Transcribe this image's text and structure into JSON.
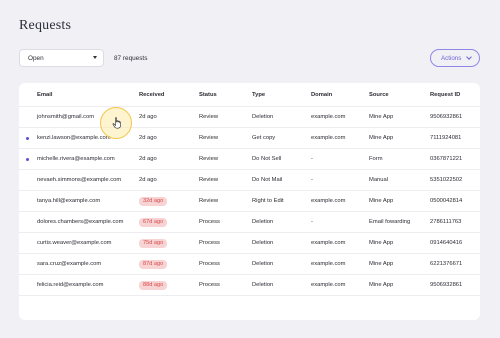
{
  "page": {
    "title": "Requests"
  },
  "filter": {
    "selected": "Open",
    "count_text": "87 requests"
  },
  "actions": {
    "label": "Actions"
  },
  "table": {
    "columns": [
      "Email",
      "Received",
      "Status",
      "Type",
      "Domain",
      "Source",
      "Request ID"
    ],
    "rows": [
      {
        "email": "johnsmith@gmail.com",
        "received": "2d ago",
        "overdue": false,
        "status": "Review",
        "type": "Deletion",
        "domain": "example.com",
        "source": "Mine App",
        "request_id": "9506932861",
        "unread": false
      },
      {
        "email": "kenzi.lawson@example.com",
        "received": "2d ago",
        "overdue": false,
        "status": "Review",
        "type": "Get copy",
        "domain": "example.com",
        "source": "Mine App",
        "request_id": "7111924081",
        "unread": true
      },
      {
        "email": "michelle.rivera@example.com",
        "received": "2d ago",
        "overdue": false,
        "status": "Review",
        "type": "Do Not Sell",
        "domain": "-",
        "source": "Form",
        "request_id": "0367871221",
        "unread": true
      },
      {
        "email": "nevaeh.simmons@example.com",
        "received": "2d ago",
        "overdue": false,
        "status": "Review",
        "type": "Do Not Mail",
        "domain": "-",
        "source": "Manual",
        "request_id": "5351022502",
        "unread": false
      },
      {
        "email": "tanya.hill@example.com",
        "received": "32d ago",
        "overdue": true,
        "status": "Review",
        "type": "Right to Edit",
        "domain": "example.com",
        "source": "Mine App",
        "request_id": "0500042814",
        "unread": false
      },
      {
        "email": "dolores.chambers@example.com",
        "received": "67d ago",
        "overdue": true,
        "status": "Process",
        "type": "Deletion",
        "domain": "-",
        "source": "Email fowarding",
        "request_id": "2786111763",
        "unread": false
      },
      {
        "email": "curtis.weaver@example.com",
        "received": "75d ago",
        "overdue": true,
        "status": "Process",
        "type": "Deletion",
        "domain": "example.com",
        "source": "Mine App",
        "request_id": "0914640416",
        "unread": false
      },
      {
        "email": "sara.cruz@example.com",
        "received": "87d ago",
        "overdue": true,
        "status": "Process",
        "type": "Deletion",
        "domain": "example.com",
        "source": "Mine App",
        "request_id": "6221376671",
        "unread": false
      },
      {
        "email": "felicia.reid@example.com",
        "received": "88d ago",
        "overdue": true,
        "status": "Process",
        "type": "Deletion",
        "domain": "example.com",
        "source": "Mine App",
        "request_id": "9506932861",
        "unread": false
      }
    ]
  },
  "colors": {
    "accent": "#6a62d6",
    "overdue_bg": "#f7d3d3",
    "overdue_text": "#d94a4a",
    "unread_dot": "#5a52d6"
  },
  "cursor": {
    "icon": "hand-pointer-icon"
  }
}
